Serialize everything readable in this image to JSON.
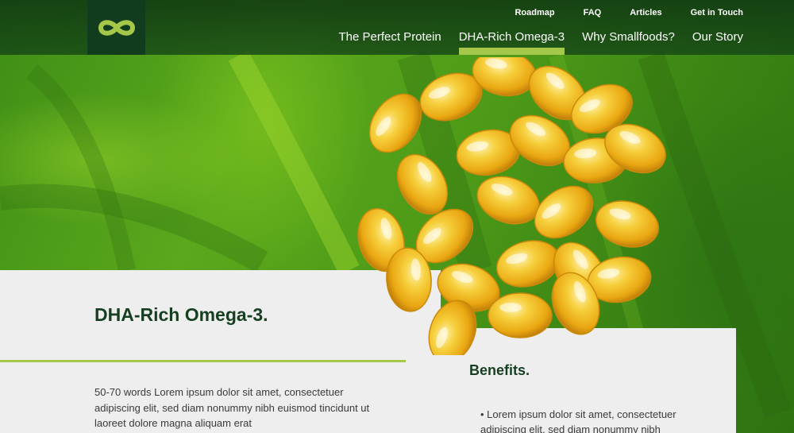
{
  "header": {
    "logo_icon": "infinity-logo-icon",
    "top_links": [
      {
        "label": "Roadmap"
      },
      {
        "label": "FAQ"
      },
      {
        "label": "Articles"
      },
      {
        "label": "Get in Touch"
      }
    ],
    "nav": [
      {
        "label": "The Perfect Protein",
        "active": false
      },
      {
        "label": "DHA-Rich Omega-3",
        "active": true
      },
      {
        "label": "Why Smallfoods?",
        "active": false
      },
      {
        "label": "Our Story",
        "active": false
      }
    ]
  },
  "main": {
    "title": "DHA-Rich Omega-3.",
    "body": "50-70 words Lorem ipsum dolor sit amet, consectetuer adipiscing elit, sed diam nonummy nibh euismod tincidunt ut laoreet dolore magna aliquam erat",
    "hero_image": "omega-3-capsules-image"
  },
  "benefits": {
    "title": "Benefits.",
    "items": [
      "Lorem ipsum dolor sit amet, consectetuer adipiscing elit, sed diam nonummy nibh"
    ]
  },
  "colors": {
    "header_dark": "#123c1e",
    "accent": "#a6c84a",
    "title_green": "#163f22",
    "panel_bg": "#eeeeee",
    "capsule_gold": "#f0b419"
  }
}
